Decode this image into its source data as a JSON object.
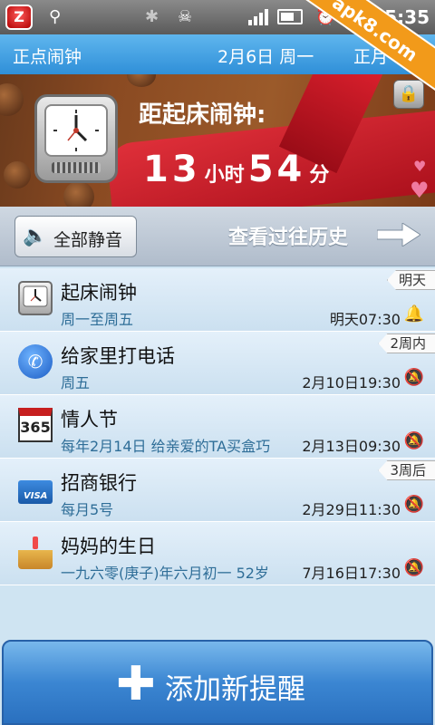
{
  "status_bar": {
    "time": "5:35",
    "app_badge": "Z"
  },
  "watermark": "apk8.com",
  "header": {
    "title": "正点闹钟",
    "date": "2月6日 周一",
    "next": "正月"
  },
  "banner": {
    "label": "距起床闹钟:",
    "hours": "13",
    "hours_unit": "小时",
    "minutes": "54",
    "minutes_unit": "分"
  },
  "actions": {
    "mute_all": "全部静音",
    "history": "查看过往历史"
  },
  "reminders": [
    {
      "icon": "alarm-clock-icon",
      "title": "起床闹钟",
      "subtitle": "周一至周五",
      "time": "明天07:30",
      "tag": "明天",
      "sound": "on"
    },
    {
      "icon": "phone-icon",
      "title": "给家里打电话",
      "subtitle": "周五",
      "time": "2月10日19:30",
      "tag": "2周内",
      "sound": "off"
    },
    {
      "icon": "calendar-365-icon",
      "title": "情人节",
      "subtitle": "每年2月14日 给亲爱的TA买盒巧",
      "time": "2月13日09:30",
      "tag": "",
      "sound": "off"
    },
    {
      "icon": "credit-card-icon",
      "title": "招商银行",
      "subtitle": "每月5号",
      "time": "2月29日11:30",
      "tag": "3周后",
      "sound": "off"
    },
    {
      "icon": "birthday-cake-icon",
      "title": "妈妈的生日",
      "subtitle": "一九六零(庚子)年六月初一 52岁",
      "time": "7月16日17:30",
      "tag": "",
      "sound": "off"
    }
  ],
  "calendar_icon_text": "365",
  "card_icon_text": "VISA",
  "add_button": {
    "label": "添加新提醒"
  }
}
